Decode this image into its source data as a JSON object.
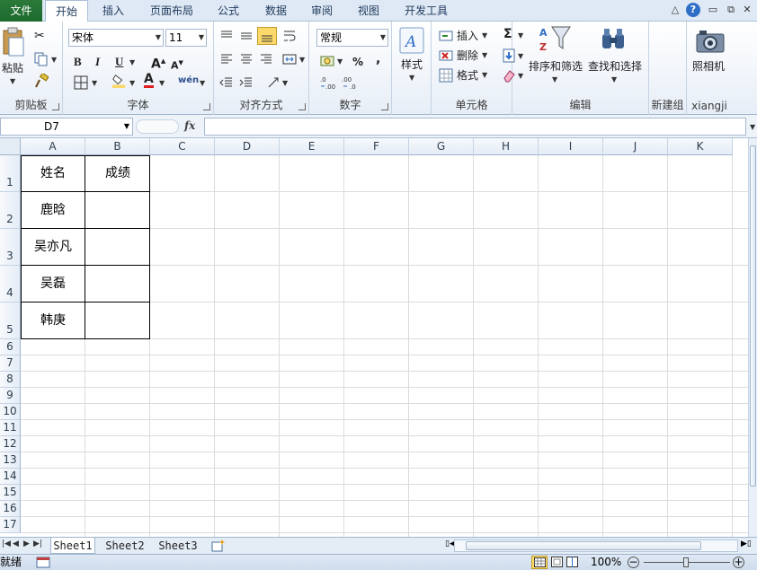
{
  "tabs": [
    "文件",
    "开始",
    "插入",
    "页面布局",
    "公式",
    "数据",
    "审阅",
    "视图",
    "开发工具"
  ],
  "ribbon": {
    "clipboard": {
      "label": "剪贴板",
      "paste": "粘贴"
    },
    "font": {
      "label": "字体",
      "name": "宋体",
      "size": "11",
      "bold": "B",
      "italic": "I",
      "underline": "U",
      "grow": "A",
      "shrink": "A",
      "font_color": "A",
      "phonetic": "wén"
    },
    "alignment": {
      "label": "对齐方式"
    },
    "number": {
      "label": "数字",
      "format": "常规",
      "percent": "%",
      "comma": ",",
      "inc_decimal": ".0→.00",
      "dec_decimal": ".00→.0"
    },
    "styles": {
      "label": "样式"
    },
    "cells": {
      "label": "单元格",
      "insert": "插入",
      "delete": "删除",
      "format": "格式"
    },
    "editing": {
      "label": "编辑",
      "sort": "排序和筛选",
      "find": "查找和选择"
    },
    "newgroup": {
      "label": "新建组"
    },
    "camera": {
      "label": "xiangji",
      "button": "照相机"
    }
  },
  "formula_bar": {
    "name_box": "D7",
    "fx": "fx",
    "value": ""
  },
  "columns": [
    "A",
    "B",
    "C",
    "D",
    "E",
    "F",
    "G",
    "H",
    "I",
    "J",
    "K"
  ],
  "rows": [
    "1",
    "2",
    "3",
    "4",
    "5",
    "6",
    "7",
    "8",
    "9",
    "10",
    "11",
    "12",
    "13",
    "14",
    "15",
    "16",
    "17"
  ],
  "table": {
    "header": [
      "姓名",
      "成绩"
    ],
    "names": [
      "鹿晗",
      "吴亦凡",
      "吴磊",
      "韩庚"
    ]
  },
  "sheets": [
    "Sheet1",
    "Sheet2",
    "Sheet3"
  ],
  "status": {
    "ready": "就绪",
    "zoom": "100%"
  },
  "colors": {
    "file_tab": "#2b7a3a",
    "accent": "#2f6fc7",
    "grid_line": "#dadcdd",
    "highlight": "#fcd96b"
  }
}
